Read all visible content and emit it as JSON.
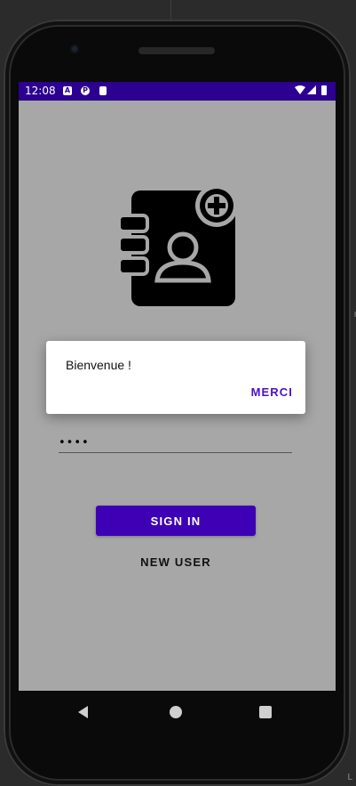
{
  "status_bar": {
    "time": "12:08",
    "notification_icons": [
      "a-box-icon",
      "p-circle-icon",
      "sd-card-icon"
    ],
    "system_icons": [
      "wifi-icon",
      "signal-icon",
      "battery-icon"
    ],
    "background": "#2c0090"
  },
  "app": {
    "logo_icon": "address-book-add-icon",
    "password_value": "••••",
    "sign_in_label": "SIGN IN",
    "new_user_label": "NEW USER",
    "accent": "#3d00b5"
  },
  "dialog": {
    "message": "Bienvenue !",
    "button_label": "MERCI"
  },
  "navigation": {
    "buttons": [
      "back-icon",
      "home-icon",
      "recents-icon"
    ]
  }
}
